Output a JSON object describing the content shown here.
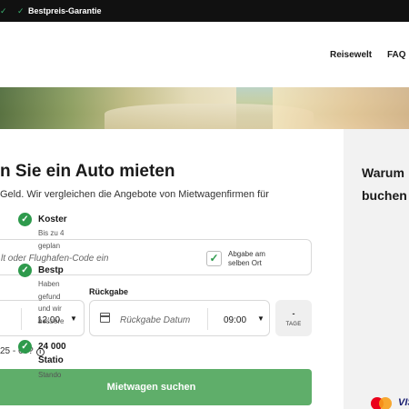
{
  "topbar": {
    "guarantee_label": "Bestpreis-Garantie",
    "icon": "check-icon"
  },
  "nav": {
    "items": [
      "Reisewelt",
      "FAQ"
    ]
  },
  "main": {
    "heading": "n Sie ein Auto mieten",
    "subheading": "Geld. Wir vergleichen die Angebote von Mietwagenfirmen für",
    "pickup_placeholder": "lt oder Flughafen-Code ein",
    "same_location": {
      "label_line1": "Abgabe am",
      "label_line2": "selben Ort",
      "checked": true
    },
    "return_label": "Rückgabe",
    "pickup_time": "12:00",
    "return_date_placeholder": "Rückgabe Datum",
    "return_time": "09:00",
    "days_value": "-",
    "days_label": "TAGE",
    "age_text": "25 - 69?",
    "search_button": "Mietwagen suchen"
  },
  "sidebar": {
    "heading_line1": "Warum",
    "heading_line2": "buchen",
    "features": [
      {
        "title": "Koster",
        "desc": [
          "Bis zu 4",
          "geplan"
        ]
      },
      {
        "title": "Bestp",
        "desc": [
          "Haben",
          "gefund",
          "und wir",
          "bessere"
        ]
      },
      {
        "title": "24 000",
        "title2": "Statio",
        "desc": [
          "Stando"
        ]
      }
    ],
    "payment": [
      "mastercard-logo",
      "VISA"
    ]
  },
  "colors": {
    "accent_green": "#2e9a4c",
    "button_green": "#5fae6a",
    "topbar_bg": "#111111"
  }
}
